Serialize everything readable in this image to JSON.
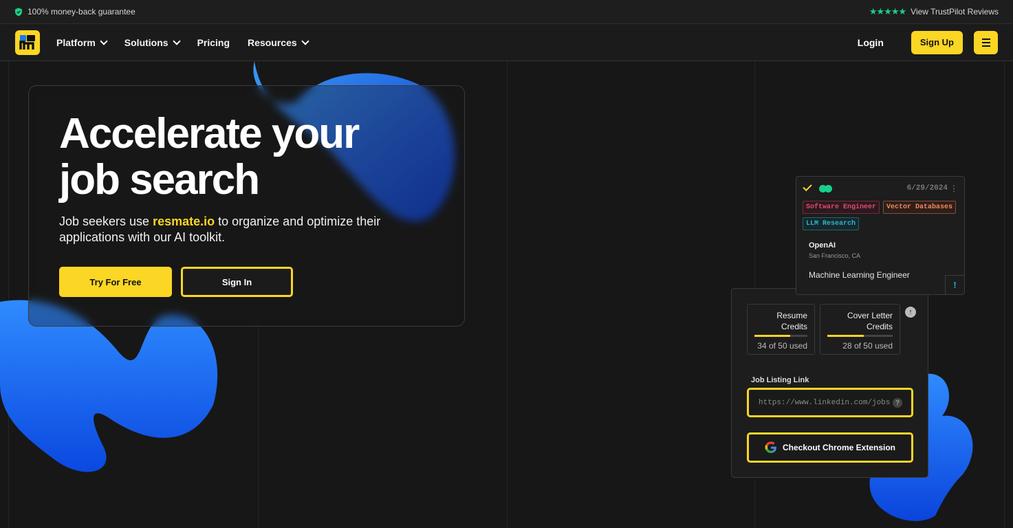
{
  "topbar": {
    "guarantee": "100% money-back guarantee",
    "reviews_link": "View TrustPilot Reviews",
    "star_color": "#19d089"
  },
  "nav": {
    "items": [
      {
        "label": "Platform",
        "dropdown": true
      },
      {
        "label": "Solutions",
        "dropdown": true
      },
      {
        "label": "Pricing",
        "dropdown": false
      },
      {
        "label": "Resources",
        "dropdown": true
      }
    ],
    "login": "Login",
    "signup": "Sign Up",
    "accent": "#fbd624"
  },
  "hero": {
    "title_line1": "Accelerate your",
    "title_line2": "job search",
    "sub_before": "Job seekers use ",
    "sub_brand": "resmate.io",
    "sub_after": " to organize and optimize their applications with our AI toolkit.",
    "try_button": "Try For Free",
    "signin_button": "Sign In"
  },
  "job_card": {
    "date": "6/29/2024",
    "tags": [
      "Software Engineer",
      "Vector Databases",
      "LLM Research"
    ],
    "company": "OpenAI",
    "location": "San Francisco, CA",
    "role": "Machine Learning Engineer",
    "alert": "!"
  },
  "extension": {
    "resume_credits": {
      "label_1": "Resume",
      "label_2": "Credits",
      "used": "34 of 50 used",
      "fraction": 0.68
    },
    "cover_credits": {
      "label_1": "Cover Letter",
      "label_2": "Credits",
      "used": "28 of 50 used",
      "fraction": 0.56
    },
    "job_link_label": "Job Listing Link",
    "job_link_placeholder": "https://www.linkedin.com/jobs/v",
    "chrome_button": "Checkout Chrome Extension"
  }
}
